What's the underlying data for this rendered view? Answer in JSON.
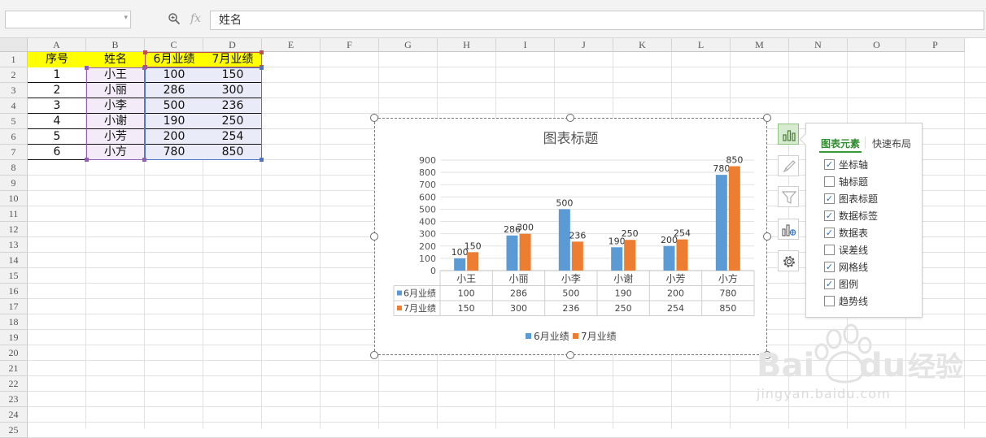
{
  "formula_bar": {
    "name_box_value": "",
    "zoom_icon": "zoom-icon",
    "fx_label": "fx",
    "formula_value": "姓名"
  },
  "sheet": {
    "columns": [
      "A",
      "B",
      "C",
      "D",
      "E",
      "F",
      "G",
      "H",
      "I",
      "J",
      "K",
      "L",
      "M",
      "N",
      "O",
      "P"
    ],
    "rows": [
      "1",
      "2",
      "3",
      "4",
      "5",
      "6",
      "7",
      "8",
      "9",
      "10",
      "11",
      "12",
      "13",
      "14",
      "15",
      "16",
      "17",
      "18",
      "19",
      "20",
      "21",
      "22",
      "23",
      "24",
      "25"
    ],
    "header": [
      "序号",
      "姓名",
      "6月业绩",
      "7月业绩"
    ],
    "data": [
      [
        "1",
        "小王",
        "100",
        "150"
      ],
      [
        "2",
        "小丽",
        "286",
        "300"
      ],
      [
        "3",
        "小李",
        "500",
        "236"
      ],
      [
        "4",
        "小谢",
        "190",
        "250"
      ],
      [
        "5",
        "小芳",
        "200",
        "254"
      ],
      [
        "6",
        "小方",
        "780",
        "850"
      ]
    ]
  },
  "chart_data": {
    "type": "bar",
    "title": "图表标题",
    "categories": [
      "小王",
      "小丽",
      "小李",
      "小谢",
      "小芳",
      "小方"
    ],
    "series": [
      {
        "name": "6月业绩",
        "color": "#5b9bd5",
        "values": [
          100,
          286,
          500,
          190,
          200,
          780
        ]
      },
      {
        "name": "7月业绩",
        "color": "#ed7d31",
        "values": [
          150,
          300,
          236,
          250,
          254,
          850
        ]
      }
    ],
    "ylim": [
      0,
      900
    ],
    "yticks": [
      "0",
      "100",
      "200",
      "300",
      "400",
      "500",
      "600",
      "700",
      "800",
      "900"
    ],
    "grid": true,
    "data_labels": true,
    "data_table": true,
    "legend_position": "bottom"
  },
  "side_buttons": [
    {
      "icon": "chart-elements-icon",
      "active": true
    },
    {
      "icon": "chart-style-brush-icon",
      "active": false
    },
    {
      "icon": "chart-filter-icon",
      "active": false
    },
    {
      "icon": "chart-data-icon",
      "active": false
    },
    {
      "icon": "chart-settings-gear-icon",
      "active": false
    }
  ],
  "panel": {
    "tab_elements": "图表元素",
    "tab_quick_layout": "快速布局",
    "options": [
      {
        "label": "坐标轴",
        "checked": true
      },
      {
        "label": "轴标题",
        "checked": false
      },
      {
        "label": "图表标题",
        "checked": true
      },
      {
        "label": "数据标签",
        "checked": true
      },
      {
        "label": "数据表",
        "checked": true
      },
      {
        "label": "误差线",
        "checked": false
      },
      {
        "label": "网格线",
        "checked": true
      },
      {
        "label": "图例",
        "checked": true
      },
      {
        "label": "趋势线",
        "checked": false
      }
    ]
  },
  "watermark": {
    "logo_text": "Baidu经验",
    "url_text": "jingyan.baidu.com"
  }
}
